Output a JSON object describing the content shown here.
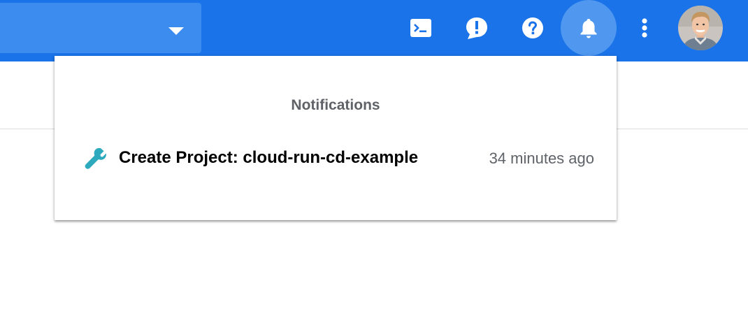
{
  "colors": {
    "header_bg": "#1a73e8",
    "project_select_bg": "#3c8cf0",
    "bell_highlight": "#4f97ef",
    "wrench": "#2eaabf",
    "muted_text": "#5f6368"
  },
  "toolbar": {
    "project_selector_icon": "caret-down-icon",
    "icons": [
      "terminal-icon",
      "feedback-icon",
      "help-icon",
      "bell-icon",
      "more-vert-icon"
    ],
    "avatar": "user-avatar"
  },
  "notifications": {
    "title": "Notifications",
    "items": [
      {
        "icon": "wrench-icon",
        "text": "Create Project: cloud-run-cd-example",
        "time": "34 minutes ago"
      }
    ]
  }
}
